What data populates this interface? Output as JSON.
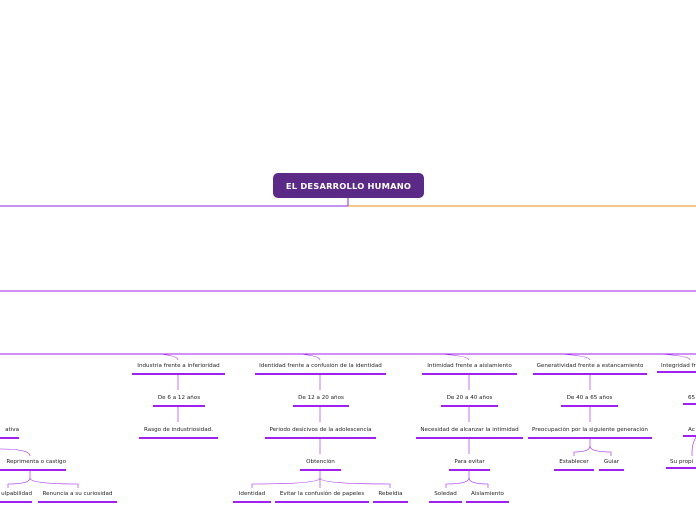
{
  "root": {
    "label": "EL DESARROLLO HUMANO"
  },
  "colors": {
    "root_bg": "#5b2a86",
    "branch_purple": "#8a2be2",
    "branch_orange": "#e8901a",
    "underline": "#a020f0"
  },
  "stages": [
    {
      "crisis": "Industria frente a inferioridad",
      "age": "De 6 a 12 años",
      "feature": "Rasgo de industriosidad."
    },
    {
      "crisis": "Identidad frente a confusión de la identidad",
      "age": "De 12 a 20 años",
      "feature": "Periodo desicivos de la adolescencia",
      "sub": "Obtención",
      "leaves": [
        "Identidad",
        "Evitar la confusión de papeles",
        "Rebeldia"
      ]
    },
    {
      "crisis": "Intimidad frente a aislamiento",
      "age": "De 20 a 40 años",
      "feature": "Necesidad de alcanzar la intimidad",
      "sub": "Para evitar",
      "leaves": [
        "Soledad",
        "Aislamiento"
      ]
    },
    {
      "crisis": "Generatividad frente a estancamiento",
      "age": "De 40 a 65 años",
      "feature": "Preocupación por la siguiente generación",
      "leaves": [
        "Establecer",
        "Guiar"
      ]
    },
    {
      "crisis": "Integridad fr",
      "age": "65",
      "feature": "Ac",
      "sub": "Su propi"
    }
  ],
  "left_fragments": {
    "feature": "ativa",
    "sub": "Reprimenta o castigo",
    "leaves": [
      "ulpabilidad",
      "Renuncia a su curiosidad"
    ]
  }
}
